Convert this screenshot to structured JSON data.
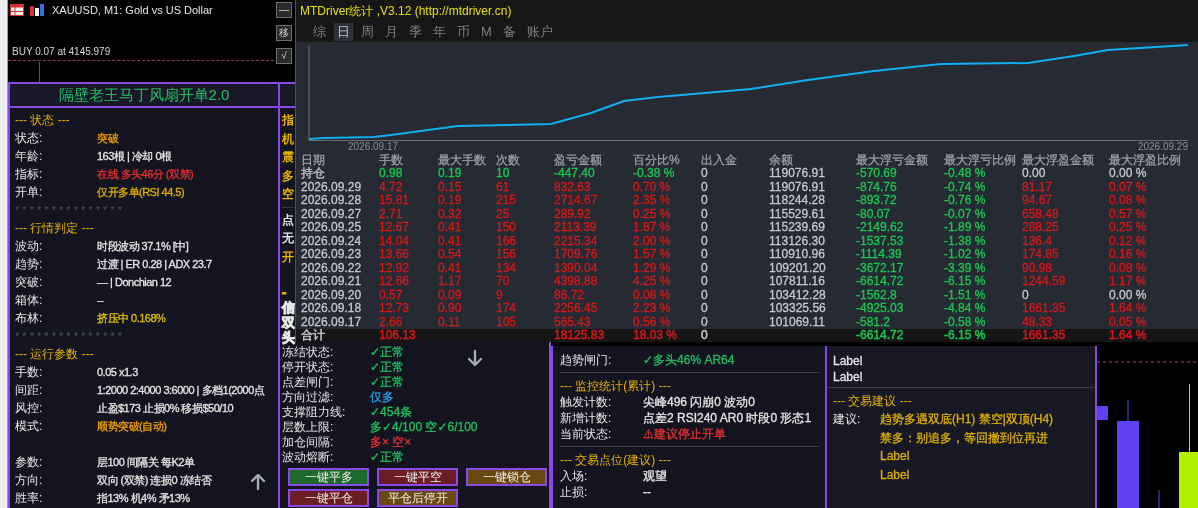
{
  "chart": {
    "title": "XAUUSD, M1:  Gold vs US Dollar",
    "buttons": [
      "—",
      "移",
      "√"
    ],
    "order": "BUY 0.07 at 4145.979"
  },
  "left_panel": {
    "title": "隔壁老王马丁风扇开单2.0",
    "rows": [
      {
        "kind": "header",
        "text": "--- 状态 ---"
      },
      {
        "kind": "row",
        "label": "状态:",
        "value": "突破",
        "color": "#f0a000"
      },
      {
        "kind": "row",
        "label": "年龄:",
        "value": "163根 | 冷却 0根",
        "color": "#e6e6e6"
      },
      {
        "kind": "row",
        "label": "指标:",
        "value": "在线 多头46分 (双禁)",
        "color": "#e83030"
      },
      {
        "kind": "row",
        "label": "开单:",
        "value": "仅开多单(RSI 44.5)",
        "color": "#e0b000"
      },
      {
        "kind": "stars",
        "text": "* * * * * * * * * * * * * * *"
      },
      {
        "kind": "header",
        "text": "--- 行情判定 ---"
      },
      {
        "kind": "row",
        "label": "波动:",
        "value": "时段波动 37.1% [中]",
        "color": "#e6e6e6"
      },
      {
        "kind": "row",
        "label": "趋势:",
        "value": "过渡 | ER 0.28 | ADX 23.7",
        "color": "#e6e6e6"
      },
      {
        "kind": "row",
        "label": "突破:",
        "value": "— | Donchian 12",
        "color": "#e6e6e6"
      },
      {
        "kind": "row",
        "label": "箱体:",
        "value": "--",
        "color": "#e6e6e6"
      },
      {
        "kind": "row",
        "label": "布林:",
        "value": "挤压中 0.168%",
        "color": "#e0c000"
      },
      {
        "kind": "stars",
        "text": "* * * * * * * * * * * * * * *"
      },
      {
        "kind": "header",
        "text": "--- 运行参数 ---"
      },
      {
        "kind": "row",
        "label": "手数:",
        "value": "0.05 x1.3",
        "color": "#e6e6e6"
      },
      {
        "kind": "row",
        "label": "间距:",
        "value": "1:2000 2:4000 3:6000 | 多档1(2000点",
        "color": "#e6e6e6"
      },
      {
        "kind": "row",
        "label": "风控:",
        "value": "止盈$173 止损0% 移损$50/10",
        "color": "#e6e6e6"
      },
      {
        "kind": "row",
        "label": "模式:",
        "value": "顺势突破(自动)",
        "color": "#f0a000"
      },
      {
        "kind": "gap"
      },
      {
        "kind": "row",
        "label": "参数:",
        "value": "层100 间隔关 每K2单",
        "color": "#e6e6e6"
      },
      {
        "kind": "row",
        "label": "方向:",
        "value": "双向 (双禁) 连损0 冻结否",
        "color": "#e6e6e6"
      },
      {
        "kind": "row",
        "label": "胜率:",
        "value": "指13% 机4% 矛13%",
        "color": "#e6e6e6"
      }
    ]
  },
  "middle_panel": {
    "rows": [
      {
        "kind": "fragment",
        "text": "指",
        "color": "#e8b000"
      },
      {
        "kind": "fragment",
        "text": "机",
        "color": "#e8b000"
      },
      {
        "kind": "fragment",
        "text": "震",
        "color": "#e8b000"
      },
      {
        "kind": "fragment",
        "text": "多",
        "color": "#e8b000"
      },
      {
        "kind": "fragment",
        "text": "空",
        "color": "#e8b000"
      },
      {
        "kind": "divider"
      },
      {
        "kind": "fragment",
        "text": "点",
        "color": "#e6e6e6"
      },
      {
        "kind": "fragment",
        "text": "无",
        "color": "#e6e6e6"
      },
      {
        "kind": "fragment",
        "text": "开",
        "color": "#e8b000"
      },
      {
        "kind": "gap"
      },
      {
        "kind": "stub",
        "text": "-",
        "color": "#e8b000"
      },
      {
        "kind": "stub",
        "text": "信",
        "color": "#e6e6e6"
      },
      {
        "kind": "stub",
        "text": "双",
        "color": "#e6e6e6"
      },
      {
        "kind": "stub",
        "text": "头",
        "color": "#e6e6e6"
      },
      {
        "kind": "line",
        "label": "冻结状态:",
        "value": "✓正常",
        "color": "#20c060"
      },
      {
        "kind": "line",
        "label": "停开状态:",
        "value": "✓正常",
        "color": "#20c060"
      },
      {
        "kind": "line",
        "label": "点差闸门:",
        "value": "✓正常",
        "color": "#20c060"
      },
      {
        "kind": "line",
        "label": "方向过滤:",
        "value": "仅多",
        "color": "#20a0e8"
      },
      {
        "kind": "line",
        "label": "支撑阻力线:",
        "value": "✓454条",
        "color": "#20c060"
      },
      {
        "kind": "line",
        "label": "层数上限:",
        "value": "多✓4/100 空✓6/100",
        "color": "#20c060"
      },
      {
        "kind": "line",
        "label": "加仓间隔:",
        "value": "多× 空×",
        "color": "#e83030"
      },
      {
        "kind": "line",
        "label": "波动熔断:",
        "value": "✓正常",
        "color": "#20c060"
      }
    ],
    "buttons": [
      {
        "label": "一键平多",
        "color": "#1e6a2c"
      },
      {
        "label": "一键平空",
        "color": "#6a1e24"
      },
      {
        "label": "一键锁仓",
        "color": "#6a4812"
      },
      {
        "label": "一键平仓",
        "color": "#6a1e24"
      },
      {
        "label": "平仓后停开",
        "color": "#6a4812"
      }
    ]
  },
  "stats_window": {
    "title": "MTDriver统计 ,V3.12 (http://mtdriver.cn)",
    "tabs": [
      {
        "label": "综",
        "selected": false
      },
      {
        "label": "日",
        "selected": true
      },
      {
        "label": "周",
        "selected": false
      },
      {
        "label": "月",
        "selected": false
      },
      {
        "label": "季",
        "selected": false
      },
      {
        "label": "年",
        "selected": false
      },
      {
        "label": "币",
        "selected": false
      },
      {
        "label": "M",
        "selected": false
      },
      {
        "label": "备",
        "selected": false
      },
      {
        "label": "账户",
        "selected": false
      }
    ],
    "chart_start": "2026.09.17",
    "chart_end": "2026.09.29",
    "columns": [
      "日期",
      "手数",
      "最大手数",
      "次数",
      "盈亏金额",
      "百分比%",
      "出入金",
      "余额",
      "最大浮亏金额",
      "最大浮亏比例",
      "最大浮盈金额",
      "最大浮盈比例"
    ],
    "rows": [
      {
        "cells": [
          {
            "text": "持仓",
            "color": "#c4c8cc"
          },
          {
            "text": "0.98",
            "color": "#18c850"
          },
          {
            "text": "0.19",
            "color": "#18c850"
          },
          {
            "text": "10",
            "color": "#18c850"
          },
          {
            "text": "-447.40",
            "color": "#18c850"
          },
          {
            "text": "-0.38 %",
            "color": "#18c850"
          },
          {
            "text": "0",
            "color": "#c4c8cc"
          },
          {
            "text": "119076.91",
            "color": "#c4c8cc"
          },
          {
            "text": "-570.69",
            "color": "#18c850"
          },
          {
            "text": "-0.48 %",
            "color": "#18c850"
          },
          {
            "text": "0.00",
            "color": "#c4c8cc"
          },
          {
            "text": "0.00 %",
            "color": "#c4c8cc"
          }
        ]
      },
      {
        "cells": [
          {
            "text": "2026.09.29",
            "color": "#c4c8cc"
          },
          {
            "text": "4.72",
            "color": "#d81818"
          },
          {
            "text": "0.15",
            "color": "#d81818"
          },
          {
            "text": "61",
            "color": "#d81818"
          },
          {
            "text": "832.63",
            "color": "#d81818"
          },
          {
            "text": "0.70 %",
            "color": "#d81818"
          },
          {
            "text": "0",
            "color": "#c4c8cc"
          },
          {
            "text": "119076.91",
            "color": "#c4c8cc"
          },
          {
            "text": "-874.76",
            "color": "#18c850"
          },
          {
            "text": "-0.74 %",
            "color": "#18c850"
          },
          {
            "text": "81.17",
            "color": "#d81818"
          },
          {
            "text": "0.07 %",
            "color": "#d81818"
          }
        ]
      },
      {
        "cells": [
          {
            "text": "2026.09.28",
            "color": "#c4c8cc"
          },
          {
            "text": "15.81",
            "color": "#d81818"
          },
          {
            "text": "0.19",
            "color": "#d81818"
          },
          {
            "text": "215",
            "color": "#d81818"
          },
          {
            "text": "2714.67",
            "color": "#d81818"
          },
          {
            "text": "2.35 %",
            "color": "#d81818"
          },
          {
            "text": "0",
            "color": "#c4c8cc"
          },
          {
            "text": "118244.28",
            "color": "#c4c8cc"
          },
          {
            "text": "-893.72",
            "color": "#18c850"
          },
          {
            "text": "-0.76 %",
            "color": "#18c850"
          },
          {
            "text": "94.67",
            "color": "#d81818"
          },
          {
            "text": "0.08 %",
            "color": "#d81818"
          }
        ]
      },
      {
        "cells": [
          {
            "text": "2026.09.27",
            "color": "#c4c8cc"
          },
          {
            "text": "2.71",
            "color": "#d81818"
          },
          {
            "text": "0.32",
            "color": "#d81818"
          },
          {
            "text": "25",
            "color": "#d81818"
          },
          {
            "text": "289.92",
            "color": "#d81818"
          },
          {
            "text": "0.25 %",
            "color": "#d81818"
          },
          {
            "text": "0",
            "color": "#c4c8cc"
          },
          {
            "text": "115529.61",
            "color": "#c4c8cc"
          },
          {
            "text": "-80.07",
            "color": "#18c850"
          },
          {
            "text": "-0.07 %",
            "color": "#18c850"
          },
          {
            "text": "658.48",
            "color": "#d81818"
          },
          {
            "text": "0.57 %",
            "color": "#d81818"
          }
        ]
      },
      {
        "cells": [
          {
            "text": "2026.09.25",
            "color": "#c4c8cc"
          },
          {
            "text": "12.67",
            "color": "#d81818"
          },
          {
            "text": "0.41",
            "color": "#d81818"
          },
          {
            "text": "150",
            "color": "#d81818"
          },
          {
            "text": "2113.39",
            "color": "#d81818"
          },
          {
            "text": "1.87 %",
            "color": "#d81818"
          },
          {
            "text": "0",
            "color": "#c4c8cc"
          },
          {
            "text": "115239.69",
            "color": "#c4c8cc"
          },
          {
            "text": "-2149.62",
            "color": "#18c850"
          },
          {
            "text": "-1.89 %",
            "color": "#18c850"
          },
          {
            "text": "288.25",
            "color": "#d81818"
          },
          {
            "text": "0.25 %",
            "color": "#d81818"
          }
        ]
      },
      {
        "cells": [
          {
            "text": "2026.09.24",
            "color": "#c4c8cc"
          },
          {
            "text": "14.04",
            "color": "#d81818"
          },
          {
            "text": "0.41",
            "color": "#d81818"
          },
          {
            "text": "166",
            "color": "#d81818"
          },
          {
            "text": "2215.34",
            "color": "#d81818"
          },
          {
            "text": "2.00 %",
            "color": "#d81818"
          },
          {
            "text": "0",
            "color": "#c4c8cc"
          },
          {
            "text": "113126.30",
            "color": "#c4c8cc"
          },
          {
            "text": "-1537.53",
            "color": "#18c850"
          },
          {
            "text": "-1.38 %",
            "color": "#18c850"
          },
          {
            "text": "136.4",
            "color": "#d81818"
          },
          {
            "text": "0.12 %",
            "color": "#d81818"
          }
        ]
      },
      {
        "cells": [
          {
            "text": "2026.09.23",
            "color": "#c4c8cc"
          },
          {
            "text": "13.66",
            "color": "#d81818"
          },
          {
            "text": "0.54",
            "color": "#d81818"
          },
          {
            "text": "156",
            "color": "#d81818"
          },
          {
            "text": "1709.76",
            "color": "#d81818"
          },
          {
            "text": "1.57 %",
            "color": "#d81818"
          },
          {
            "text": "0",
            "color": "#c4c8cc"
          },
          {
            "text": "110910.96",
            "color": "#c4c8cc"
          },
          {
            "text": "-1114.39",
            "color": "#18c850"
          },
          {
            "text": "-1.02 %",
            "color": "#18c850"
          },
          {
            "text": "174.85",
            "color": "#d81818"
          },
          {
            "text": "0.16 %",
            "color": "#d81818"
          }
        ]
      },
      {
        "cells": [
          {
            "text": "2026.09.22",
            "color": "#c4c8cc"
          },
          {
            "text": "12.92",
            "color": "#d81818"
          },
          {
            "text": "0.41",
            "color": "#d81818"
          },
          {
            "text": "134",
            "color": "#d81818"
          },
          {
            "text": "1390.04",
            "color": "#d81818"
          },
          {
            "text": "1.29 %",
            "color": "#d81818"
          },
          {
            "text": "0",
            "color": "#c4c8cc"
          },
          {
            "text": "109201.20",
            "color": "#c4c8cc"
          },
          {
            "text": "-3672.17",
            "color": "#18c850"
          },
          {
            "text": "-3.39 %",
            "color": "#18c850"
          },
          {
            "text": "90.98",
            "color": "#d81818"
          },
          {
            "text": "0.08 %",
            "color": "#d81818"
          }
        ]
      },
      {
        "cells": [
          {
            "text": "2026.09.21",
            "color": "#c4c8cc"
          },
          {
            "text": "12.66",
            "color": "#d81818"
          },
          {
            "text": "1.17",
            "color": "#d81818"
          },
          {
            "text": "70",
            "color": "#d81818"
          },
          {
            "text": "4398.88",
            "color": "#d81818"
          },
          {
            "text": "4.25 %",
            "color": "#d81818"
          },
          {
            "text": "0",
            "color": "#c4c8cc"
          },
          {
            "text": "107811.16",
            "color": "#c4c8cc"
          },
          {
            "text": "-6614.72",
            "color": "#18c850"
          },
          {
            "text": "-6.15 %",
            "color": "#18c850"
          },
          {
            "text": "1244.59",
            "color": "#d81818"
          },
          {
            "text": "1.17 %",
            "color": "#d81818"
          }
        ]
      },
      {
        "cells": [
          {
            "text": "2026.09.20",
            "color": "#c4c8cc"
          },
          {
            "text": "0.57",
            "color": "#d81818"
          },
          {
            "text": "0.09",
            "color": "#d81818"
          },
          {
            "text": "9",
            "color": "#d81818"
          },
          {
            "text": "86.72",
            "color": "#d81818"
          },
          {
            "text": "0.08 %",
            "color": "#d81818"
          },
          {
            "text": "0",
            "color": "#c4c8cc"
          },
          {
            "text": "103412.28",
            "color": "#c4c8cc"
          },
          {
            "text": "-1562.8",
            "color": "#18c850"
          },
          {
            "text": "-1.51 %",
            "color": "#18c850"
          },
          {
            "text": "0",
            "color": "#c4c8cc"
          },
          {
            "text": "0.00 %",
            "color": "#c4c8cc"
          }
        ]
      },
      {
        "cells": [
          {
            "text": "2026.09.18",
            "color": "#c4c8cc"
          },
          {
            "text": "12.73",
            "color": "#d81818"
          },
          {
            "text": "0.90",
            "color": "#d81818"
          },
          {
            "text": "174",
            "color": "#d81818"
          },
          {
            "text": "2256.45",
            "color": "#d81818"
          },
          {
            "text": "2.23 %",
            "color": "#d81818"
          },
          {
            "text": "0",
            "color": "#c4c8cc"
          },
          {
            "text": "103325.56",
            "color": "#c4c8cc"
          },
          {
            "text": "-4925.03",
            "color": "#18c850"
          },
          {
            "text": "-4.84 %",
            "color": "#18c850"
          },
          {
            "text": "1661.35",
            "color": "#d81818"
          },
          {
            "text": "1.64 %",
            "color": "#d81818"
          }
        ]
      },
      {
        "cells": [
          {
            "text": "2026.09.17",
            "color": "#c4c8cc"
          },
          {
            "text": "2.66",
            "color": "#d81818"
          },
          {
            "text": "0.11",
            "color": "#d81818"
          },
          {
            "text": "105",
            "color": "#d81818"
          },
          {
            "text": "565.43",
            "color": "#d81818"
          },
          {
            "text": "0.56 %",
            "color": "#d81818"
          },
          {
            "text": "0",
            "color": "#c4c8cc"
          },
          {
            "text": "101069.11",
            "color": "#c4c8cc"
          },
          {
            "text": "-581.2",
            "color": "#18c850"
          },
          {
            "text": "-0.58 %",
            "color": "#18c850"
          },
          {
            "text": "48.33",
            "color": "#d81818"
          },
          {
            "text": "0.05 %",
            "color": "#d81818"
          }
        ]
      }
    ],
    "total": {
      "cells": [
        {
          "text": "合计",
          "color": "#c4c8cc"
        },
        {
          "text": "106.13",
          "color": "#d81818"
        },
        null,
        null,
        {
          "text": "18125.83",
          "color": "#d81818"
        },
        {
          "text": "18.03 %",
          "color": "#d81818"
        },
        {
          "text": "0",
          "color": "#c4c8cc"
        },
        null,
        {
          "text": "-6614.72",
          "color": "#18c850"
        },
        {
          "text": "-6.15 %",
          "color": "#18c850"
        },
        {
          "text": "1661.35",
          "color": "#d81818"
        },
        {
          "text": "1.64 %",
          "color": "#d81818"
        }
      ]
    }
  },
  "monitor_panel": {
    "rows": [
      {
        "kind": "line",
        "label": "趋势闸门:",
        "value": "✓多头46% AR64",
        "color": "#20c060"
      },
      {
        "kind": "divider"
      },
      {
        "kind": "header",
        "text": "--- 监控统计(累计) ---"
      },
      {
        "kind": "line",
        "label": "触发计数:",
        "value": "尖峰496 闪崩0 波动0",
        "color": "#e6e6e6"
      },
      {
        "kind": "line",
        "label": "新增计数:",
        "value": "点差2 RSI240 AR0 时段0 形态1",
        "color": "#e6e6e6"
      },
      {
        "kind": "line",
        "label": "当前状态:",
        "value": "⚠建议停止开单",
        "color": "#e83030"
      },
      {
        "kind": "divider"
      },
      {
        "kind": "header",
        "text": "--- 交易点位(建议) ---"
      },
      {
        "kind": "line",
        "label": "入场:",
        "value": "观望",
        "color": "#e6e6e6"
      },
      {
        "kind": "line",
        "label": "止损:",
        "value": "--",
        "color": "#e6e6e6"
      }
    ]
  },
  "advice_panel": {
    "rows": [
      {
        "kind": "stub",
        "text": "Label",
        "color": "#e6e6e6"
      },
      {
        "kind": "stub",
        "text": "Label",
        "color": "#e6e6e6"
      },
      {
        "kind": "divider"
      },
      {
        "kind": "header",
        "text": "--- 交易建议 ---"
      },
      {
        "kind": "line",
        "label": "建议:",
        "value": "趋势多遇双底(H1) 禁空|双顶(H4)",
        "color": "#e0b000"
      },
      {
        "kind": "line",
        "label": "",
        "value": "禁多：别追多，等回撤到位再进",
        "color": "#e0b000"
      },
      {
        "kind": "line",
        "label": "",
        "value": "Label",
        "color": "#e0b000"
      },
      {
        "kind": "line",
        "label": "",
        "value": "Label",
        "color": "#e0b000"
      }
    ]
  }
}
